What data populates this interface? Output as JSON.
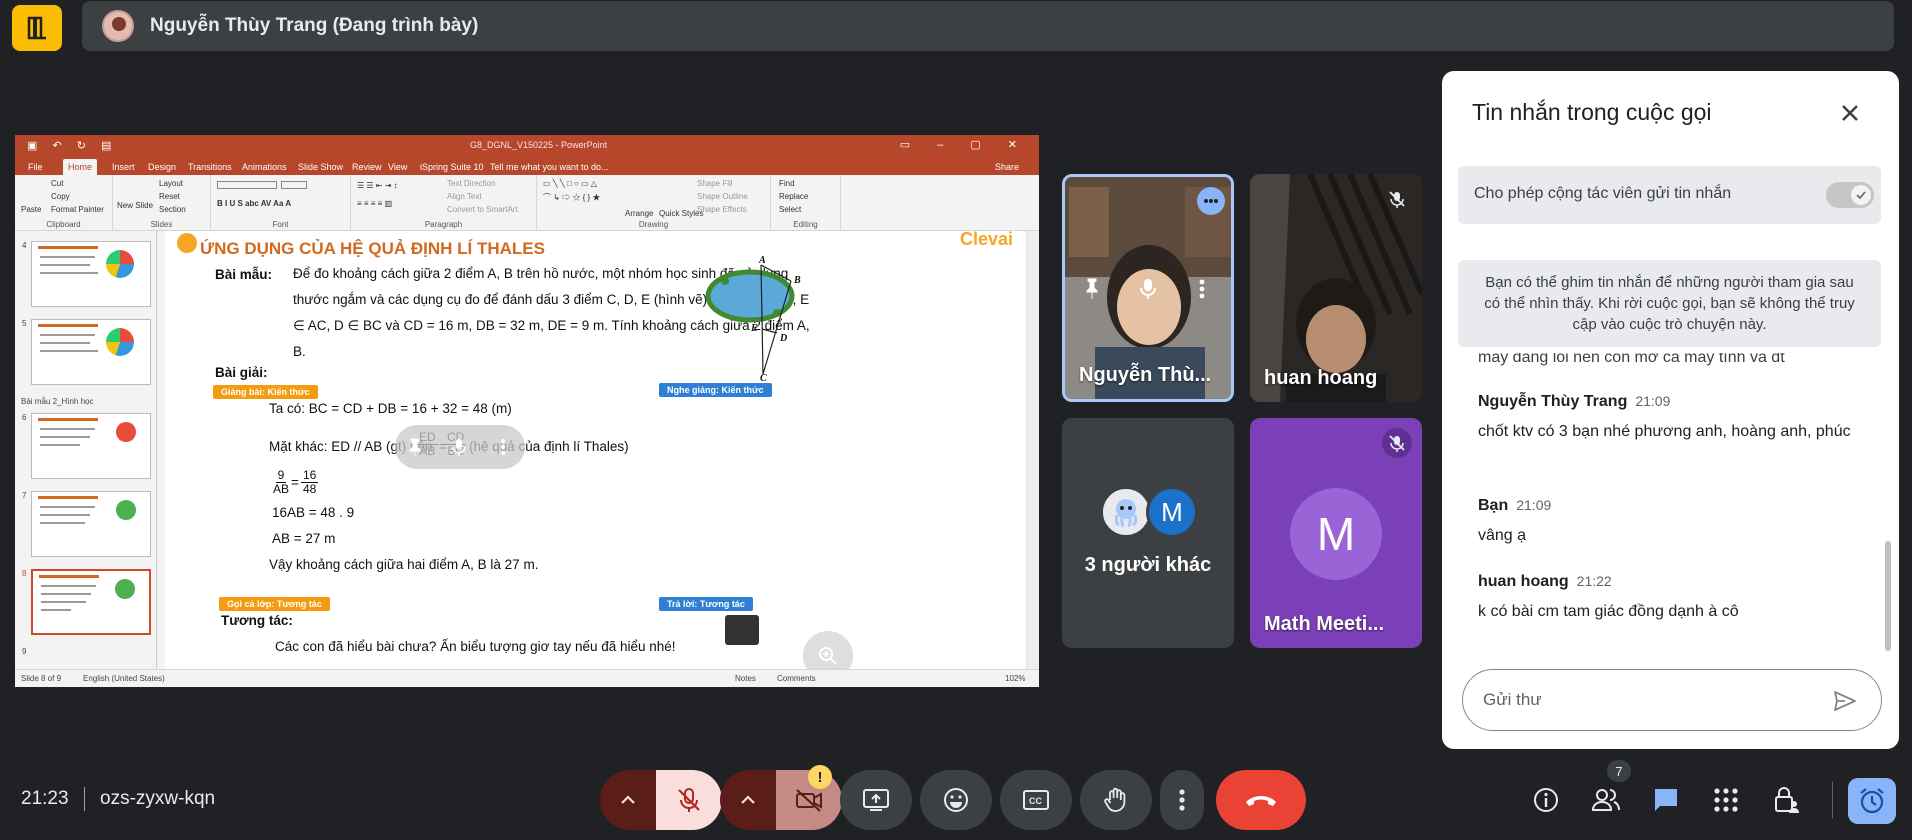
{
  "presenter_bar": {
    "name": "Nguyễn Thùy Trang (Đang trình bày)"
  },
  "ppt": {
    "title": "G8_DGNL_V150225 - PowerPoint",
    "tabs": [
      "File",
      "Home",
      "Insert",
      "Design",
      "Transitions",
      "Animations",
      "Slide Show",
      "Review",
      "View",
      "iSpring Suite 10",
      "Tell me what you want to do...",
      "Share"
    ],
    "ribbon": {
      "clipboard": {
        "paste": "Paste",
        "cut": "Cut",
        "copy": "Copy",
        "format_painter": "Format Painter",
        "group": "Clipboard"
      },
      "slides": {
        "new_slide": "New Slide",
        "layout": "Layout",
        "reset": "Reset",
        "section": "Section",
        "group": "Slides"
      },
      "font_group": "Font",
      "paragraph": {
        "text_direction": "Text Direction",
        "align_text": "Align Text",
        "smartart": "Convert to SmartArt",
        "group": "Paragraph"
      },
      "drawing": {
        "arrange": "Arrange",
        "quick_styles": "Quick Styles",
        "shape_fill": "Shape Fill",
        "shape_outline": "Shape Outline",
        "shape_effects": "Shape Effects",
        "group": "Drawing"
      },
      "editing": {
        "find": "Find",
        "replace": "Replace",
        "select": "Select",
        "group": "Editing"
      }
    },
    "thumbnails": [
      {
        "no": "4"
      },
      {
        "no": "5"
      },
      {
        "no": "6"
      },
      {
        "no": "7"
      },
      {
        "no": "8"
      },
      {
        "no": "9"
      }
    ],
    "section_label": "Bài mẫu 2_Hình học",
    "status": {
      "slide": "Slide 8 of 9",
      "lang": "English (United States)",
      "notes": "Notes",
      "comments": "Comments",
      "zoom": "102%"
    }
  },
  "slide": {
    "title": "ỨNG DỤNG CỦA HỆ QUẢ ĐỊNH LÍ THALES",
    "logo": "Clevai",
    "bai_mau_label": "Bài mẫu:",
    "problem": "Để đo khoảng cách giữa 2 điểm A, B trên hồ nước, một nhóm học sinh đã sử dụng thước ngắm và các dụng cụ đo để đánh dấu 3 điểm C, D, E (hình vẽ). Biết ED // AB, E ∈ AC, D ∈ BC và CD = 16 m, DB = 32 m, DE = 9 m. Tính khoảng cách giữa 2 điểm A, B.",
    "bai_giai_label": "Bài giải:",
    "badge_giang_bai": "Giảng bài: Kiến thức",
    "badge_nghe_giang": "Nghe giảng: Kiến thức",
    "line1": "Ta có: BC = CD + DB = 16 + 32 = 48 (m)",
    "line2_a": "Mặt khác: ED // AB (gt) nên",
    "frac1": {
      "num": "ED",
      "den": "AB"
    },
    "eq": "=",
    "frac2": {
      "num": "CD",
      "den": "BC"
    },
    "line2_b": "(hệ quả của định lí Thales)",
    "frac3": {
      "num": "9",
      "den": "AB"
    },
    "frac4": {
      "num": "16",
      "den": "48"
    },
    "line3": "16AB = 48 . 9",
    "line4": "AB = 27 m",
    "line5": "Vậy khoảng cách giữa hai điểm A, B là 27 m.",
    "badge_goi_ca_lop": "Gọi cả lớp: Tương tác",
    "badge_tra_loi": "Trả lời: Tương tác",
    "tuong_tac_label": "Tương tác:",
    "question": "Các con đã hiểu bài chưa? Ấn biểu tượng giơ tay nếu đã hiểu nhé!",
    "diagram_labels": [
      "A",
      "B",
      "E",
      "D",
      "C"
    ]
  },
  "participants": {
    "tile1_name": "Nguyễn Thù...",
    "tile2_name": "huan hoang",
    "tile3_name": "3 người khác",
    "tile3_avatar_letter": "M",
    "tile4_name": "Math Meeti...",
    "tile4_letter": "M"
  },
  "chat": {
    "title": "Tin nhắn trong cuộc gọi",
    "toggle_label": "Cho phép cộng tác viên gửi tin nhắn",
    "info": "Bạn có thể ghim tin nhắn để những người tham gia sau có thể nhìn thấy. Khi rời cuộc gọi, bạn sẽ không thể truy cập vào cuộc trò chuyện này.",
    "partial_msg": "máy đang lỗi nên con mở cả máy tính và đt",
    "messages": [
      {
        "sender": "Nguyễn Thùy Trang",
        "time": "21:09",
        "text": "chốt ktv có 3 bạn nhé phương anh, hoàng anh, phúc"
      },
      {
        "sender": "Bạn",
        "time": "21:09",
        "text": "vâng ạ"
      },
      {
        "sender": "huan hoang",
        "time": "21:22",
        "text": "k có bài cm tam giác đồng dạnh à cô"
      }
    ],
    "input_placeholder": "Gửi thư"
  },
  "bottom": {
    "time": "21:23",
    "code": "ozs-zyxw-kqn",
    "people_count": "7",
    "warning": "!"
  },
  "colors": {
    "background": "#202124",
    "end_call": "#ea4335",
    "ppt_accent": "#b7472a",
    "app_icon": "#fbbc04",
    "math_tile": "#7b3fb8"
  }
}
